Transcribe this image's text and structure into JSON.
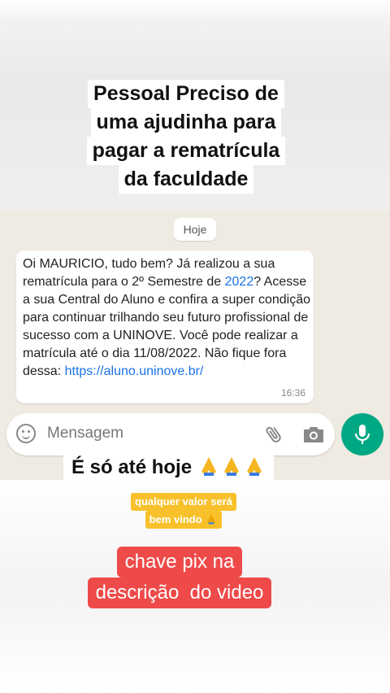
{
  "overlay": {
    "title_lines": [
      "Pessoal Preciso de",
      "uma ajudinha para",
      "pagar a rematrícula",
      "da faculdade"
    ],
    "deadline_text": "É só até hoje",
    "support_lines": [
      "qualquer valor será",
      "bem vindo"
    ],
    "pix_lines": [
      "chave pix na",
      "descrição  do video"
    ]
  },
  "chat": {
    "day_label": "Hoje",
    "message": {
      "part1": "Oi MAURICIO, tudo bem? Já realizou a sua rematrícula para o 2º Semestre de ",
      "year": "2022",
      "part2": "? Acesse a sua Central do Aluno e confira a super condição para continuar trilhando seu futuro profissional de sucesso com a UNINOVE. Você pode realizar a matrícula até o dia 11/08/2022. Não fique fora dessa: ",
      "link": "https://aluno.uninove.br/",
      "time": "16:36"
    },
    "input_placeholder": "Mensagem"
  },
  "icons": {
    "emoji": "emoji-icon",
    "attach": "paperclip-icon",
    "camera": "camera-icon",
    "mic": "microphone-icon",
    "pray": "praying-hands-emoji"
  },
  "colors": {
    "send_green": "#00a884",
    "link_blue": "#1a73e8",
    "chat_bg": "#efeae2",
    "label_yellow": "#f8c12b",
    "label_red": "#ef4a4a"
  }
}
